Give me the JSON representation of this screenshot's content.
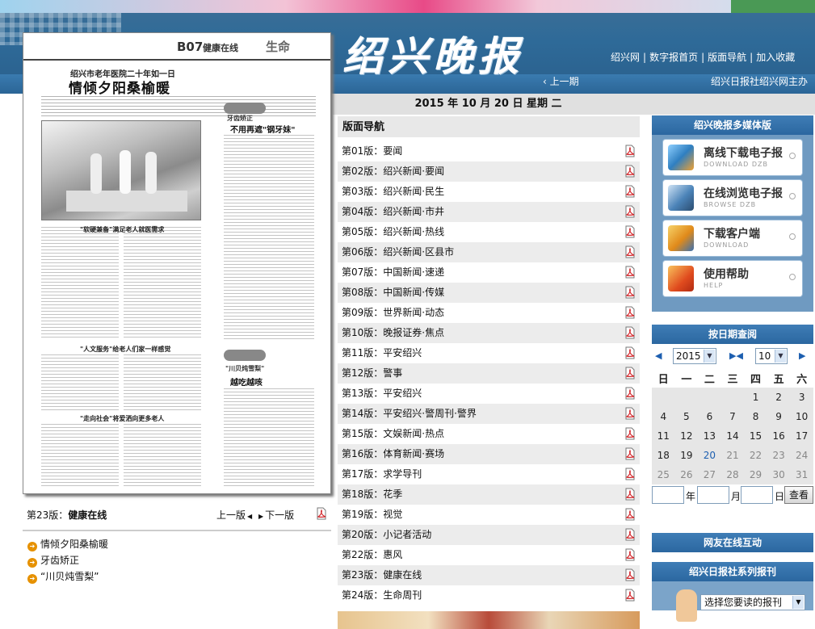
{
  "header": {
    "logo_text": "绍兴晚报",
    "top_links": [
      "绍兴网",
      "数字报首页",
      "版面导航",
      "加入收藏"
    ],
    "prev_link": "上一期",
    "sponsor": "绍兴日报社绍兴网主办"
  },
  "date_bar": {
    "year": "2015",
    "month": "10",
    "day": "20",
    "weekday": "星期 二",
    "text": "2015 年  10 月  20 日    星期 二"
  },
  "newspaper_page": {
    "page_number": "B07",
    "section": "健康在线",
    "life_label": "生命",
    "kicker": "绍兴市老年医院二十年如一日",
    "headline": "情倾夕阳桑榆暖",
    "subhead_1": "\"软硬兼备\"满足老人就医需求",
    "subhead_2": "\"人文服务\"给老人们家一样感觉",
    "subhead_3": "\"走向社会\"将爱洒向更多老人",
    "side_badge": "口腔健康工作室",
    "side_kicker": "牙齿矫正",
    "side_title": "不用再遮\"钢牙妹\"",
    "side_badge_2": "饮食好帮手",
    "side_kicker_2": "\"川贝炖雪梨\"",
    "side_title_2": "越吃越咳"
  },
  "current_page": {
    "label": "第23版：",
    "name": "健康在线",
    "prev": "上一版",
    "next": "下一版"
  },
  "articles": [
    "情倾夕阳桑榆暖",
    "牙齿矫正",
    "“川贝炖雪梨”"
  ],
  "nav": {
    "title": "版面导航",
    "items": [
      "第01版：要闻",
      "第02版：绍兴新闻·要闻",
      "第03版：绍兴新闻·民生",
      "第04版：绍兴新闻·市井",
      "第05版：绍兴新闻·热线",
      "第06版：绍兴新闻·区县市",
      "第07版：中国新闻·速递",
      "第08版：中国新闻·传媒",
      "第09版：世界新闻·动态",
      "第10版：晚报证券·焦点",
      "第11版：平安绍兴",
      "第12版：警事",
      "第13版：平安绍兴",
      "第14版：平安绍兴·警周刊·警界",
      "第15版：文娱新闻·热点",
      "第16版：体育新闻·赛场",
      "第17版：求学导刊",
      "第18版：花季",
      "第19版：视觉",
      "第20版：小记者活动",
      "第22版：惠风",
      "第23版：健康在线",
      "第24版：生命周刊"
    ]
  },
  "media_box": {
    "title": "绍兴晚报多媒体版",
    "items": [
      {
        "label": "离线下载电子报",
        "sub": "DOWNLOAD DZB",
        "icon": "books-icon"
      },
      {
        "label": "在线浏览电子报",
        "sub": "BROWSE DZB",
        "icon": "monitor-icon"
      },
      {
        "label": "下载客户端",
        "sub": "DOWNLOAD",
        "icon": "chip-icon"
      },
      {
        "label": "使用帮助",
        "sub": "HELP",
        "icon": "help-book-icon"
      }
    ]
  },
  "calendar": {
    "title": "按日期查阅",
    "year": "2015",
    "month": "10",
    "weekdays": [
      "日",
      "一",
      "二",
      "三",
      "四",
      "五",
      "六"
    ],
    "rows": [
      [
        "",
        "",
        "",
        "",
        "1",
        "2",
        "3"
      ],
      [
        "4",
        "5",
        "6",
        "7",
        "8",
        "9",
        "10"
      ],
      [
        "11",
        "12",
        "13",
        "14",
        "15",
        "16",
        "17"
      ],
      [
        "18",
        "19",
        "20",
        "21",
        "22",
        "23",
        "24"
      ],
      [
        "25",
        "26",
        "27",
        "28",
        "29",
        "30",
        "31"
      ]
    ],
    "today": "20",
    "year_label": "年",
    "month_label": "月",
    "day_label": "日",
    "query_button": "查看"
  },
  "interact_box": {
    "title": "网友在线互动"
  },
  "series_box": {
    "title": "绍兴日报社系列报刊",
    "select_placeholder": "选择您要读的报刊"
  },
  "colors": {
    "accent": "#2e6a98",
    "pdf_red": "#d2262a",
    "bullet": "#e69100"
  }
}
